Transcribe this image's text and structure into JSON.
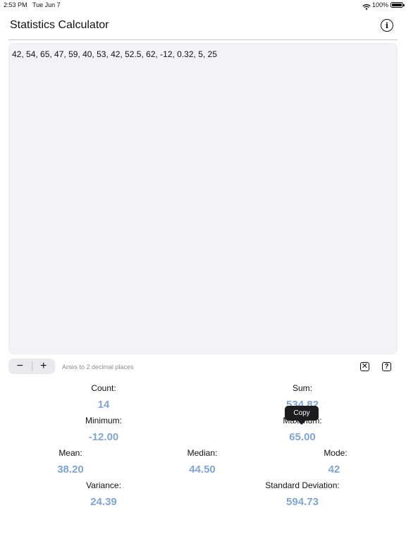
{
  "status_bar": {
    "time": "2:53 PM",
    "date": "Tue Jun 7",
    "battery": "100%",
    "battery_level": 1.0
  },
  "header": {
    "title": "Statistics Calculator",
    "info_icon": "info-circle-icon"
  },
  "input": {
    "text": "42, 54, 65, 47, 59, 40, 53, 42, 52.5, 62, -12, 0.32, 5, 25"
  },
  "toolbar": {
    "minus_label": "−",
    "plus_label": "+",
    "hint": "Anws to 2 decimal places",
    "clear_icon": "x-square-icon",
    "help_icon": "question-square-icon"
  },
  "stats": {
    "count": {
      "label": "Count:",
      "value": "14"
    },
    "sum": {
      "label": "Sum:",
      "value": "534.82"
    },
    "minimum": {
      "label": "Minimum:",
      "value": "-12.00"
    },
    "maximum": {
      "label": "Maximum:",
      "value": "65.00"
    },
    "mean": {
      "label": "Mean:",
      "value": "38.20"
    },
    "median": {
      "label": "Median:",
      "value": "44.50"
    },
    "mode": {
      "label": "Mode:",
      "value": "42"
    },
    "variance": {
      "label": "Variance:",
      "value": "24.39"
    },
    "std_dev": {
      "label": "Standard Deviation:",
      "value": "594.73"
    }
  },
  "tooltip": {
    "label": "Copy"
  },
  "colors": {
    "value_accent": "#7fa5da",
    "textarea_bg": "#f2f2f7"
  }
}
